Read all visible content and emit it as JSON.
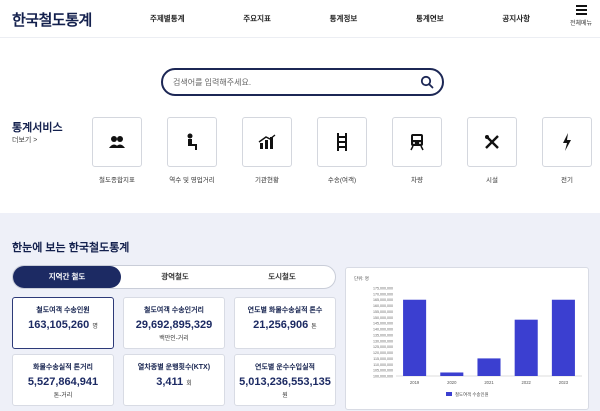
{
  "header": {
    "logo": "한국철도통계",
    "nav": [
      "주제별통계",
      "주요지표",
      "통계정보",
      "통계연보",
      "공지사항"
    ],
    "menu_label": "전체메뉴"
  },
  "search": {
    "placeholder": "검색어를 입력해주세요."
  },
  "services": {
    "title": "통계서비스",
    "more": "더보기 >",
    "items": [
      {
        "label": "철도종합지표",
        "icon": "people-icon"
      },
      {
        "label": "역수 및 영업거리",
        "icon": "seat-icon"
      },
      {
        "label": "기관현황",
        "icon": "bar-chart-icon"
      },
      {
        "label": "수송(여객)",
        "icon": "rail-track-icon"
      },
      {
        "label": "차량",
        "icon": "train-icon"
      },
      {
        "label": "시설",
        "icon": "tools-icon"
      },
      {
        "label": "전기",
        "icon": "lightning-icon"
      }
    ]
  },
  "overview": {
    "title": "한눈에 보는 한국철도통계",
    "tabs": [
      "지역간 철도",
      "광역철도",
      "도시철도"
    ],
    "active_tab": 0,
    "cards": [
      {
        "title": "철도여객 수송인원",
        "value": "163,105,260",
        "unit": "명"
      },
      {
        "title": "철도여객 수송인거리",
        "value": "29,692,895,329",
        "unit": "백만인-거리"
      },
      {
        "title": "연도별 화물수송실적 톤수",
        "value": "21,256,906",
        "unit": "톤"
      },
      {
        "title": "화물수송실적 톤거리",
        "value": "5,527,864,941",
        "unit": "톤-거리"
      },
      {
        "title": "열차종별 운행횟수(KTX)",
        "value": "3,411",
        "unit": "회"
      },
      {
        "title": "연도별 운수수입실적",
        "value": "5,013,236,553,135",
        "unit": "원"
      }
    ]
  },
  "colors": {
    "navy": "#1c2a63",
    "bar": "#3b3fd0"
  },
  "chart_data": {
    "type": "bar",
    "categories": [
      "2019",
      "2020",
      "2021",
      "2022",
      "2023"
    ],
    "series": [
      {
        "name": "철도여객 수송인원",
        "values": [
          165000000,
          103000000,
          115000000,
          148000000,
          165000000
        ]
      }
    ],
    "ylabel": "단위: 명",
    "ylim": [
      100000000,
      175000000
    ],
    "yticks": [
      "100,000,000",
      "105,000,000",
      "110,000,000",
      "115,000,000",
      "120,000,000",
      "125,000,000",
      "130,000,000",
      "135,000,000",
      "140,000,000",
      "145,000,000",
      "150,000,000",
      "155,000,000",
      "160,000,000",
      "165,000,000",
      "170,000,000",
      "175,000,000"
    ],
    "legend": "bottom",
    "grid": false
  }
}
